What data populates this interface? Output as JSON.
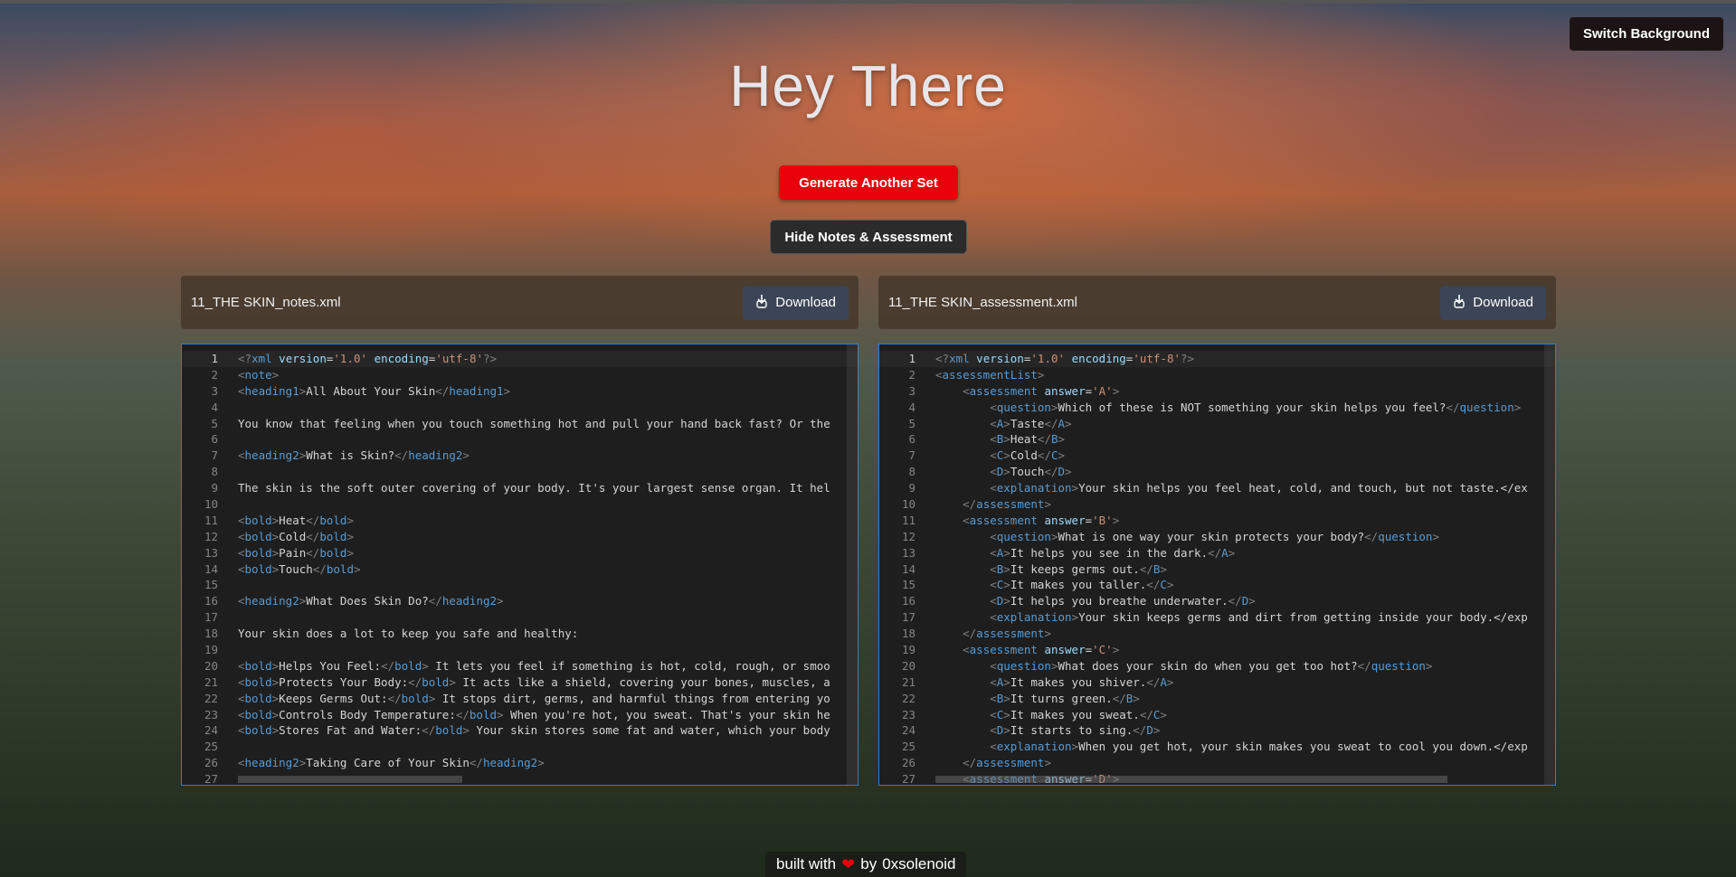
{
  "header": {
    "title": "Hey There",
    "switch_background_label": "Switch Background",
    "generate_label": "Generate Another Set",
    "hide_label": "Hide Notes & Assessment"
  },
  "notes_panel": {
    "filename": "11_THE SKIN_notes.xml",
    "download_label": "Download",
    "lines": [
      "<?xml version='1.0' encoding='utf-8'?>",
      "<note>",
      "<heading1>All About Your Skin</heading1>",
      "",
      "You know that feeling when you touch something hot and pull your hand back fast? Or the",
      "",
      "<heading2>What is Skin?</heading2>",
      "",
      "The skin is the soft outer covering of your body. It's your largest sense organ. It hel",
      "",
      "<bold>Heat</bold>",
      "<bold>Cold</bold>",
      "<bold>Pain</bold>",
      "<bold>Touch</bold>",
      "",
      "<heading2>What Does Skin Do?</heading2>",
      "",
      "Your skin does a lot to keep you safe and healthy:",
      "",
      "<bold>Helps You Feel:</bold> It lets you feel if something is hot, cold, rough, or smoo",
      "<bold>Protects Your Body:</bold> It acts like a shield, covering your bones, muscles, a",
      "<bold>Keeps Germs Out:</bold> It stops dirt, germs, and harmful things from entering yo",
      "<bold>Controls Body Temperature:</bold> When you're hot, you sweat. That's your skin he",
      "<bold>Stores Fat and Water:</bold> Your skin stores some fat and water, which your body",
      "",
      "<heading2>Taking Care of Your Skin</heading2>",
      ""
    ]
  },
  "assessment_panel": {
    "filename": "11_THE SKIN_assessment.xml",
    "download_label": "Download",
    "lines": [
      "<?xml version='1.0' encoding='utf-8'?>",
      "<assessmentList>",
      "    <assessment answer='A'>",
      "        <question>Which of these is NOT something your skin helps you feel?</question>",
      "        <A>Taste</A>",
      "        <B>Heat</B>",
      "        <C>Cold</C>",
      "        <D>Touch</D>",
      "        <explanation>Your skin helps you feel heat, cold, and touch, but not taste.</ex",
      "    </assessment>",
      "    <assessment answer='B'>",
      "        <question>What is one way your skin protects your body?</question>",
      "        <A>It helps you see in the dark.</A>",
      "        <B>It keeps germs out.</B>",
      "        <C>It makes you taller.</C>",
      "        <D>It helps you breathe underwater.</D>",
      "        <explanation>Your skin keeps germs and dirt from getting inside your body.</exp",
      "    </assessment>",
      "    <assessment answer='C'>",
      "        <question>What does your skin do when you get too hot?</question>",
      "        <A>It makes you shiver.</A>",
      "        <B>It turns green.</B>",
      "        <C>It makes you sweat.</C>",
      "        <D>It starts to sing.</D>",
      "        <explanation>When you get hot, your skin makes you sweat to cool you down.</exp",
      "    </assessment>",
      "    <assessment answer='D'>"
    ]
  },
  "footer": {
    "built_with": "built with",
    "by": "by",
    "author": "0xsolenoid"
  }
}
